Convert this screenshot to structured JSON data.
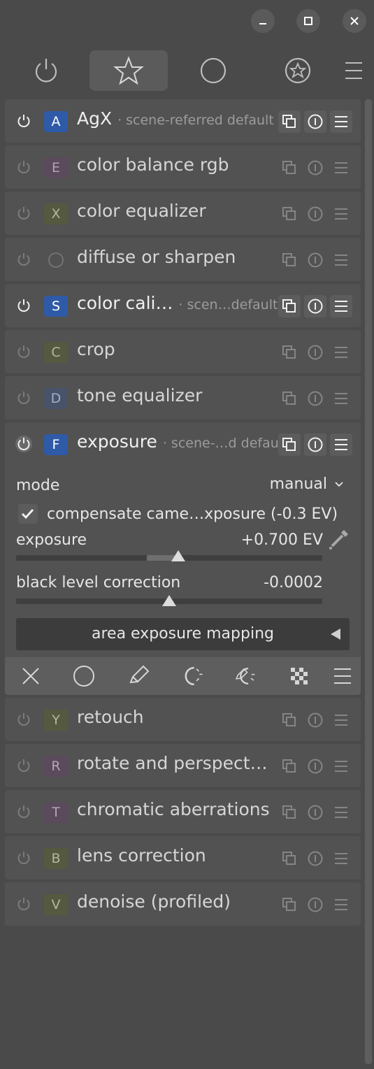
{
  "window": {
    "controls": [
      "minimize-icon",
      "maximize-icon",
      "close-icon"
    ]
  },
  "tabs": [
    {
      "icon": "power-icon",
      "active": false
    },
    {
      "icon": "star-icon",
      "active": true
    },
    {
      "icon": "circle-icon",
      "active": false
    },
    {
      "icon": "presets-icon",
      "active": false
    }
  ],
  "modules_top": [
    {
      "letter": "A",
      "name": "AgX",
      "preset": "· scene-referred default",
      "on": true,
      "badge_bg": "#2f5aa8",
      "badge_fg": "#ffffff"
    },
    {
      "letter": "E",
      "name": "color balance rgb",
      "preset": "",
      "on": false,
      "badge_bg": "#5a4a5c",
      "badge_fg": "#b6a3b8"
    },
    {
      "letter": "X",
      "name": "color equalizer",
      "preset": "",
      "on": false,
      "badge_bg": "#55593f",
      "badge_fg": "#b5b89c"
    },
    {
      "letter": "",
      "name": "diffuse or sharpen",
      "preset": "",
      "on": false,
      "badge_bg": "transparent",
      "badge_fg": "#8a8a8a"
    },
    {
      "letter": "S",
      "name": "color cali…",
      "preset": "· scen…default",
      "on": true,
      "badge_bg": "#2f5aa8",
      "badge_fg": "#ffffff"
    },
    {
      "letter": "C",
      "name": "crop",
      "preset": "",
      "on": false,
      "badge_bg": "#55593f",
      "badge_fg": "#b5b89c"
    },
    {
      "letter": "D",
      "name": "tone equalizer",
      "preset": "",
      "on": false,
      "badge_bg": "#48536a",
      "badge_fg": "#9fb0cc"
    }
  ],
  "exposure_module": {
    "letter": "F",
    "name": "exposure",
    "preset": "· scene-…d default",
    "mode_label": "mode",
    "mode_value": "manual",
    "compensate_label": "compensate came…xposure (-0.3 EV)",
    "compensate_checked": true,
    "exposure_label": "exposure",
    "exposure_value": "+0.700 EV",
    "exposure_level": 0.53,
    "black_label": "black level correction",
    "black_value": "-0.0002",
    "black_level": 0.5,
    "area_mapping_label": "area exposure mapping",
    "mask_icons": [
      "off-mask-icon",
      "drawn-mask-icon",
      "pencil-icon",
      "parametric-mask-icon",
      "drawn-parametric-mask-icon",
      "raster-mask-icon",
      "menu-icon"
    ]
  },
  "modules_bottom": [
    {
      "letter": "Y",
      "name": "retouch",
      "preset": "",
      "on": false,
      "badge_bg": "#55593f",
      "badge_fg": "#b5b89c"
    },
    {
      "letter": "R",
      "name": "rotate and perspect…",
      "preset": "",
      "on": false,
      "badge_bg": "#5a4a5c",
      "badge_fg": "#b6a3b8"
    },
    {
      "letter": "T",
      "name": "chromatic aberrations",
      "preset": "",
      "on": false,
      "badge_bg": "#5a4a5c",
      "badge_fg": "#b6a3b8"
    },
    {
      "letter": "B",
      "name": "lens correction",
      "preset": "",
      "on": false,
      "badge_bg": "#55593f",
      "badge_fg": "#b5b89c"
    },
    {
      "letter": "V",
      "name": "denoise (profiled)",
      "preset": "",
      "on": false,
      "badge_bg": "#55593f",
      "badge_fg": "#b5b89c"
    }
  ]
}
